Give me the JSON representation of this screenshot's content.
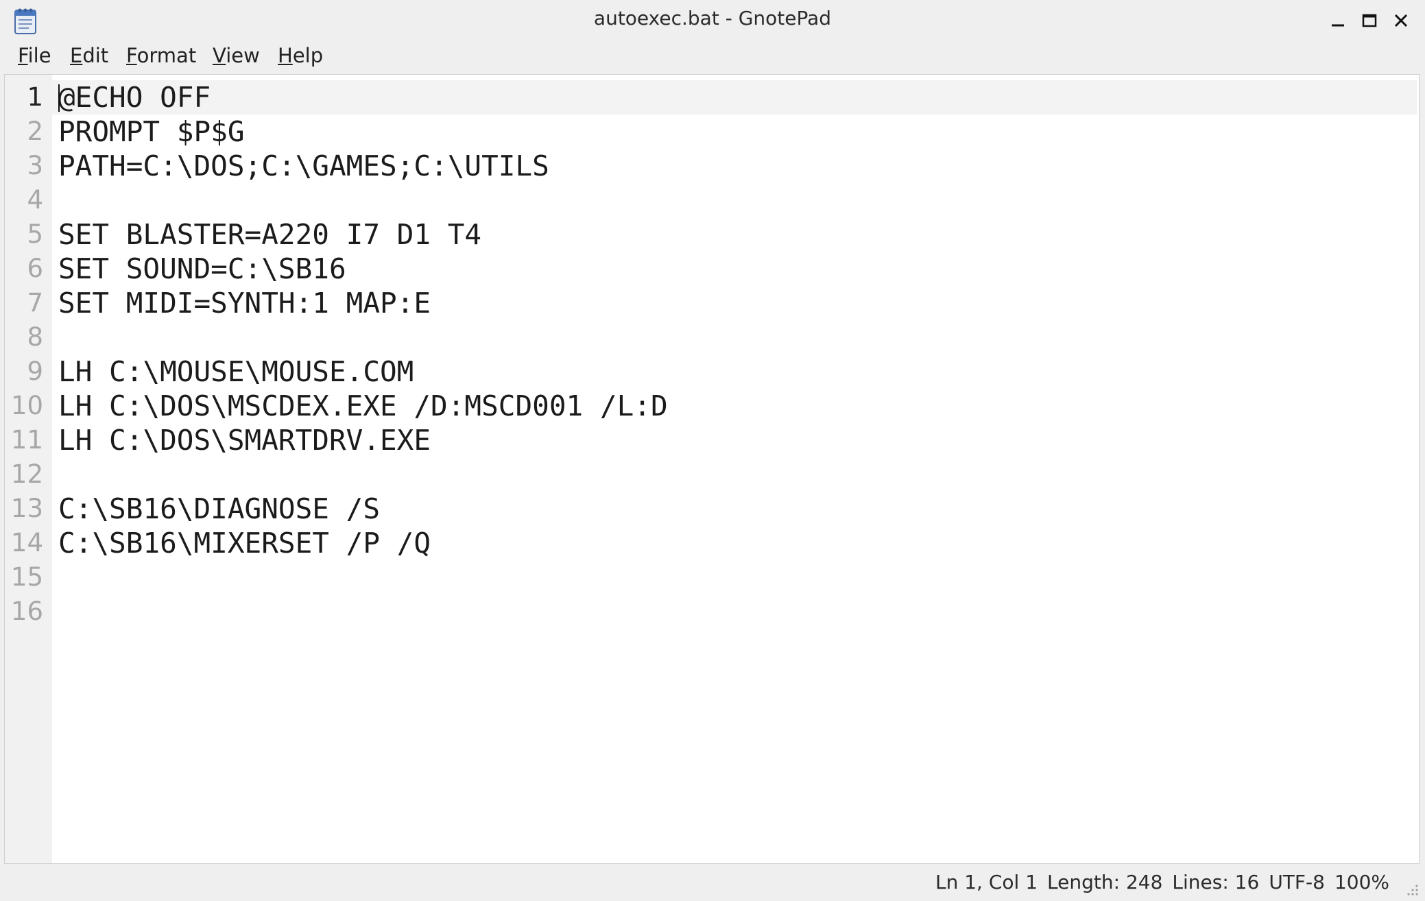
{
  "window": {
    "title": "autoexec.bat - GnotePad",
    "app_icon": "notepad-icon"
  },
  "title_buttons": {
    "minimize": "minimize-icon",
    "maximize": "maximize-icon",
    "close": "close-icon"
  },
  "menu": {
    "items": [
      {
        "mnemonic": "F",
        "rest": "ile"
      },
      {
        "mnemonic": "E",
        "rest": "dit"
      },
      {
        "mnemonic": "F",
        "rest": "ormat"
      },
      {
        "mnemonic": "V",
        "rest": "iew"
      },
      {
        "mnemonic": "H",
        "rest": "elp"
      }
    ]
  },
  "editor": {
    "lines": [
      {
        "num": "1",
        "text": "@ECHO OFF"
      },
      {
        "num": "2",
        "text": "PROMPT $P$G"
      },
      {
        "num": "3",
        "text": "PATH=C:\\DOS;C:\\GAMES;C:\\UTILS"
      },
      {
        "num": "4",
        "text": ""
      },
      {
        "num": "5",
        "text": "SET BLASTER=A220 I7 D1 T4"
      },
      {
        "num": "6",
        "text": "SET SOUND=C:\\SB16"
      },
      {
        "num": "7",
        "text": "SET MIDI=SYNTH:1 MAP:E"
      },
      {
        "num": "8",
        "text": ""
      },
      {
        "num": "9",
        "text": "LH C:\\MOUSE\\MOUSE.COM"
      },
      {
        "num": "10",
        "text": "LH C:\\DOS\\MSCDEX.EXE /D:MSCD001 /L:D"
      },
      {
        "num": "11",
        "text": "LH C:\\DOS\\SMARTDRV.EXE"
      },
      {
        "num": "12",
        "text": ""
      },
      {
        "num": "13",
        "text": "C:\\SB16\\DIAGNOSE /S"
      },
      {
        "num": "14",
        "text": "C:\\SB16\\MIXERSET /P /Q"
      },
      {
        "num": "15",
        "text": ""
      },
      {
        "num": "16",
        "text": ""
      }
    ]
  },
  "status": {
    "position": "Ln 1, Col 1",
    "length": "Length: 248",
    "lines": "Lines: 16",
    "encoding": "UTF-8",
    "zoom": "100%"
  }
}
